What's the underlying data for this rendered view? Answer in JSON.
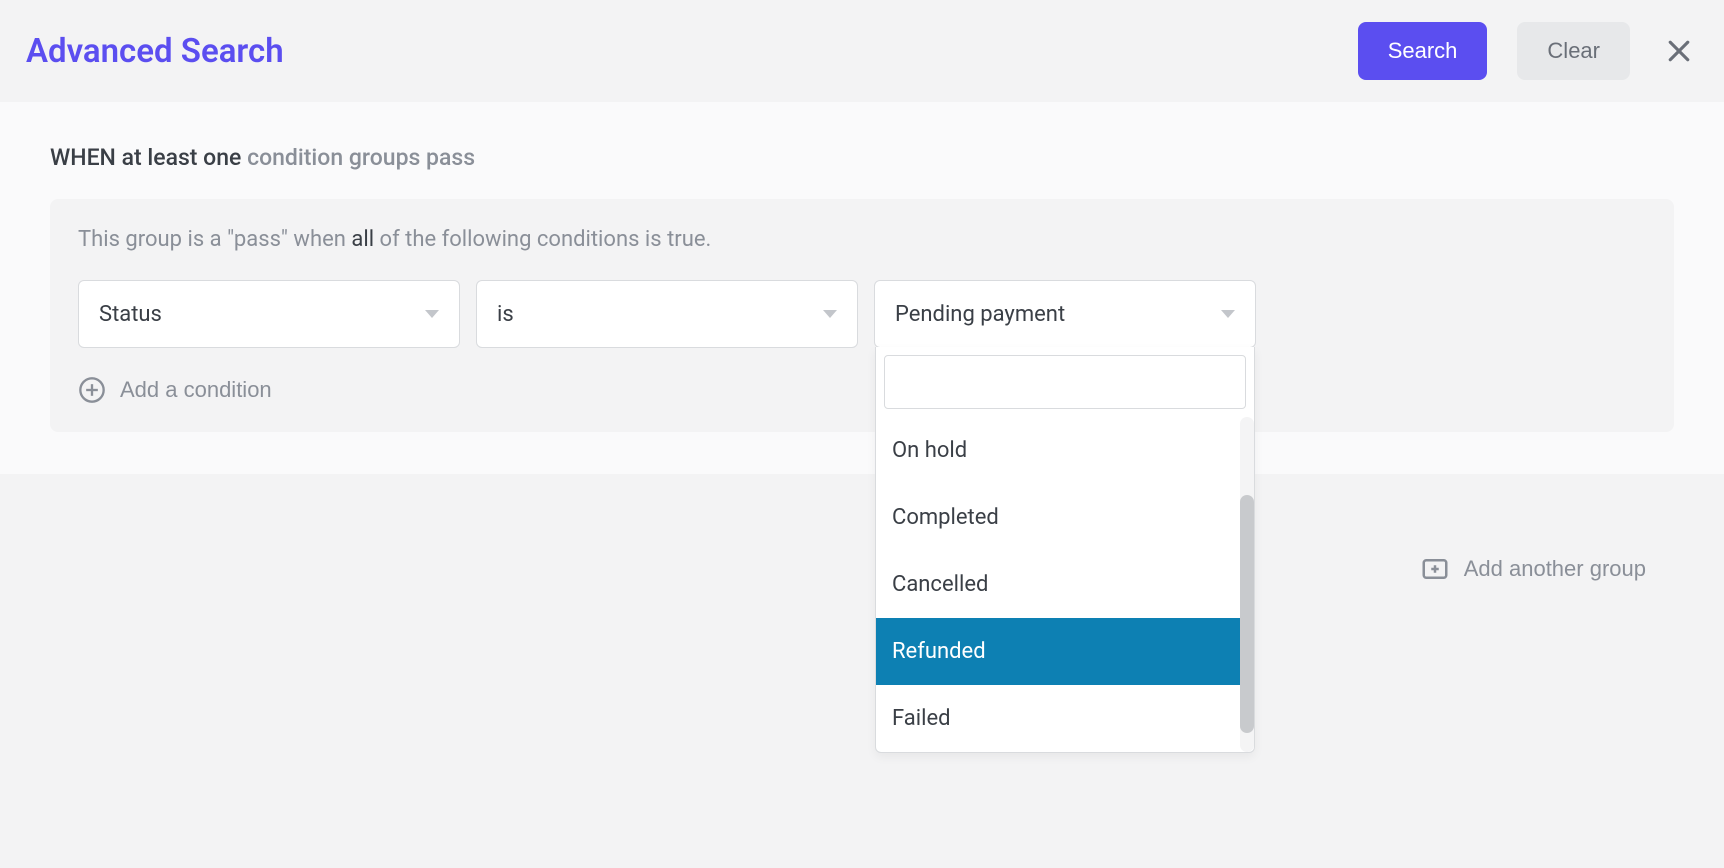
{
  "header": {
    "title": "Advanced Search",
    "search_label": "Search",
    "clear_label": "Clear"
  },
  "rule": {
    "prefix": "WHEN",
    "operator": "at least one",
    "suffix": "condition groups pass"
  },
  "group": {
    "desc_prefix": "This group is a \"pass\" when",
    "desc_operator": "all",
    "desc_suffix": "of the following conditions is true."
  },
  "condition": {
    "field": "Status",
    "comparator": "is",
    "value": "Pending payment"
  },
  "dropdown": {
    "search_value": "",
    "options": [
      "On hold",
      "Completed",
      "Cancelled",
      "Refunded",
      "Failed"
    ],
    "highlighted": "Refunded"
  },
  "actions": {
    "add_condition": "Add a condition",
    "add_group": "Add another group"
  }
}
